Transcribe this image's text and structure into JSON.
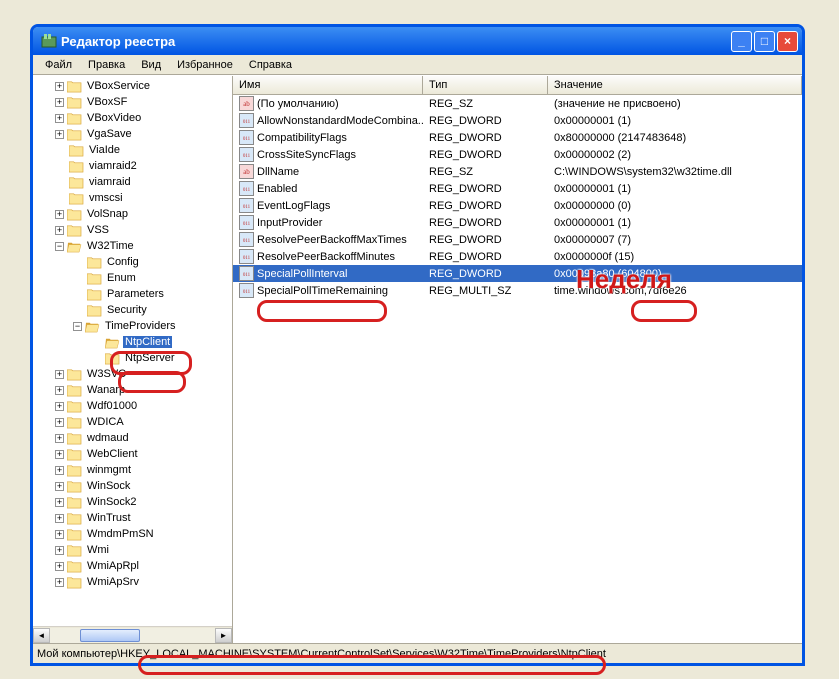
{
  "window": {
    "title": "Редактор реестра"
  },
  "menu": {
    "file": "Файл",
    "edit": "Правка",
    "view": "Вид",
    "favorites": "Избранное",
    "help": "Справка"
  },
  "columns": {
    "name": "Имя",
    "type": "Тип",
    "value": "Значение"
  },
  "tree": [
    {
      "indent": 0,
      "exp": "+",
      "label": "VBoxService"
    },
    {
      "indent": 0,
      "exp": "+",
      "label": "VBoxSF"
    },
    {
      "indent": 0,
      "exp": "+",
      "label": "VBoxVideo"
    },
    {
      "indent": 0,
      "exp": "+",
      "label": "VgaSave"
    },
    {
      "indent": 0,
      "exp": "",
      "label": "ViaIde"
    },
    {
      "indent": 0,
      "exp": "",
      "label": "viamraid2"
    },
    {
      "indent": 0,
      "exp": "",
      "label": "viamraid"
    },
    {
      "indent": 0,
      "exp": "",
      "label": "vmscsi"
    },
    {
      "indent": 0,
      "exp": "+",
      "label": "VolSnap"
    },
    {
      "indent": 0,
      "exp": "+",
      "label": "VSS"
    },
    {
      "indent": 0,
      "exp": "−",
      "label": "W32Time",
      "open": true
    },
    {
      "indent": 1,
      "exp": "",
      "label": "Config"
    },
    {
      "indent": 1,
      "exp": "",
      "label": "Enum"
    },
    {
      "indent": 1,
      "exp": "",
      "label": "Parameters"
    },
    {
      "indent": 1,
      "exp": "",
      "label": "Security"
    },
    {
      "indent": 1,
      "exp": "−",
      "label": "TimeProviders",
      "open": true
    },
    {
      "indent": 2,
      "exp": "",
      "label": "NtpClient",
      "selected": true,
      "open": true
    },
    {
      "indent": 2,
      "exp": "",
      "label": "NtpServer"
    },
    {
      "indent": 0,
      "exp": "+",
      "label": "W3SVC"
    },
    {
      "indent": 0,
      "exp": "+",
      "label": "Wanarp"
    },
    {
      "indent": 0,
      "exp": "+",
      "label": "Wdf01000"
    },
    {
      "indent": 0,
      "exp": "+",
      "label": "WDICA"
    },
    {
      "indent": 0,
      "exp": "+",
      "label": "wdmaud"
    },
    {
      "indent": 0,
      "exp": "+",
      "label": "WebClient"
    },
    {
      "indent": 0,
      "exp": "+",
      "label": "winmgmt"
    },
    {
      "indent": 0,
      "exp": "+",
      "label": "WinSock"
    },
    {
      "indent": 0,
      "exp": "+",
      "label": "WinSock2"
    },
    {
      "indent": 0,
      "exp": "+",
      "label": "WinTrust"
    },
    {
      "indent": 0,
      "exp": "+",
      "label": "WmdmPmSN"
    },
    {
      "indent": 0,
      "exp": "+",
      "label": "Wmi"
    },
    {
      "indent": 0,
      "exp": "+",
      "label": "WmiApRpl"
    },
    {
      "indent": 0,
      "exp": "+",
      "label": "WmiApSrv"
    }
  ],
  "values": [
    {
      "icon": "str",
      "name": "(По умолчанию)",
      "type": "REG_SZ",
      "value": "(значение не присвоено)"
    },
    {
      "icon": "bin",
      "name": "AllowNonstandardModeCombina...",
      "type": "REG_DWORD",
      "value": "0x00000001 (1)"
    },
    {
      "icon": "bin",
      "name": "CompatibilityFlags",
      "type": "REG_DWORD",
      "value": "0x80000000 (2147483648)"
    },
    {
      "icon": "bin",
      "name": "CrossSiteSyncFlags",
      "type": "REG_DWORD",
      "value": "0x00000002 (2)"
    },
    {
      "icon": "str",
      "name": "DllName",
      "type": "REG_SZ",
      "value": "C:\\WINDOWS\\system32\\w32time.dll"
    },
    {
      "icon": "bin",
      "name": "Enabled",
      "type": "REG_DWORD",
      "value": "0x00000001 (1)"
    },
    {
      "icon": "bin",
      "name": "EventLogFlags",
      "type": "REG_DWORD",
      "value": "0x00000000 (0)"
    },
    {
      "icon": "bin",
      "name": "InputProvider",
      "type": "REG_DWORD",
      "value": "0x00000001 (1)"
    },
    {
      "icon": "bin",
      "name": "ResolvePeerBackoffMaxTimes",
      "type": "REG_DWORD",
      "value": "0x00000007 (7)"
    },
    {
      "icon": "bin",
      "name": "ResolvePeerBackoffMinutes",
      "type": "REG_DWORD",
      "value": "0x0000000f (15)"
    },
    {
      "icon": "bin",
      "name": "SpecialPollInterval",
      "type": "REG_DWORD",
      "value": "0x00093a80 (604800)",
      "selected": true
    },
    {
      "icon": "bin",
      "name": "SpecialPollTimeRemaining",
      "type": "REG_MULTI_SZ",
      "value": "time.windows.com,7df6e26"
    }
  ],
  "status": {
    "prefix": "Мой компьютер",
    "path": "\\HKEY_LOCAL_MACHINE\\SYSTEM\\CurrentControlSet\\Services\\W32Time\\TimeProviders\\NtpClient"
  },
  "annotations": {
    "week": "Неделя"
  }
}
